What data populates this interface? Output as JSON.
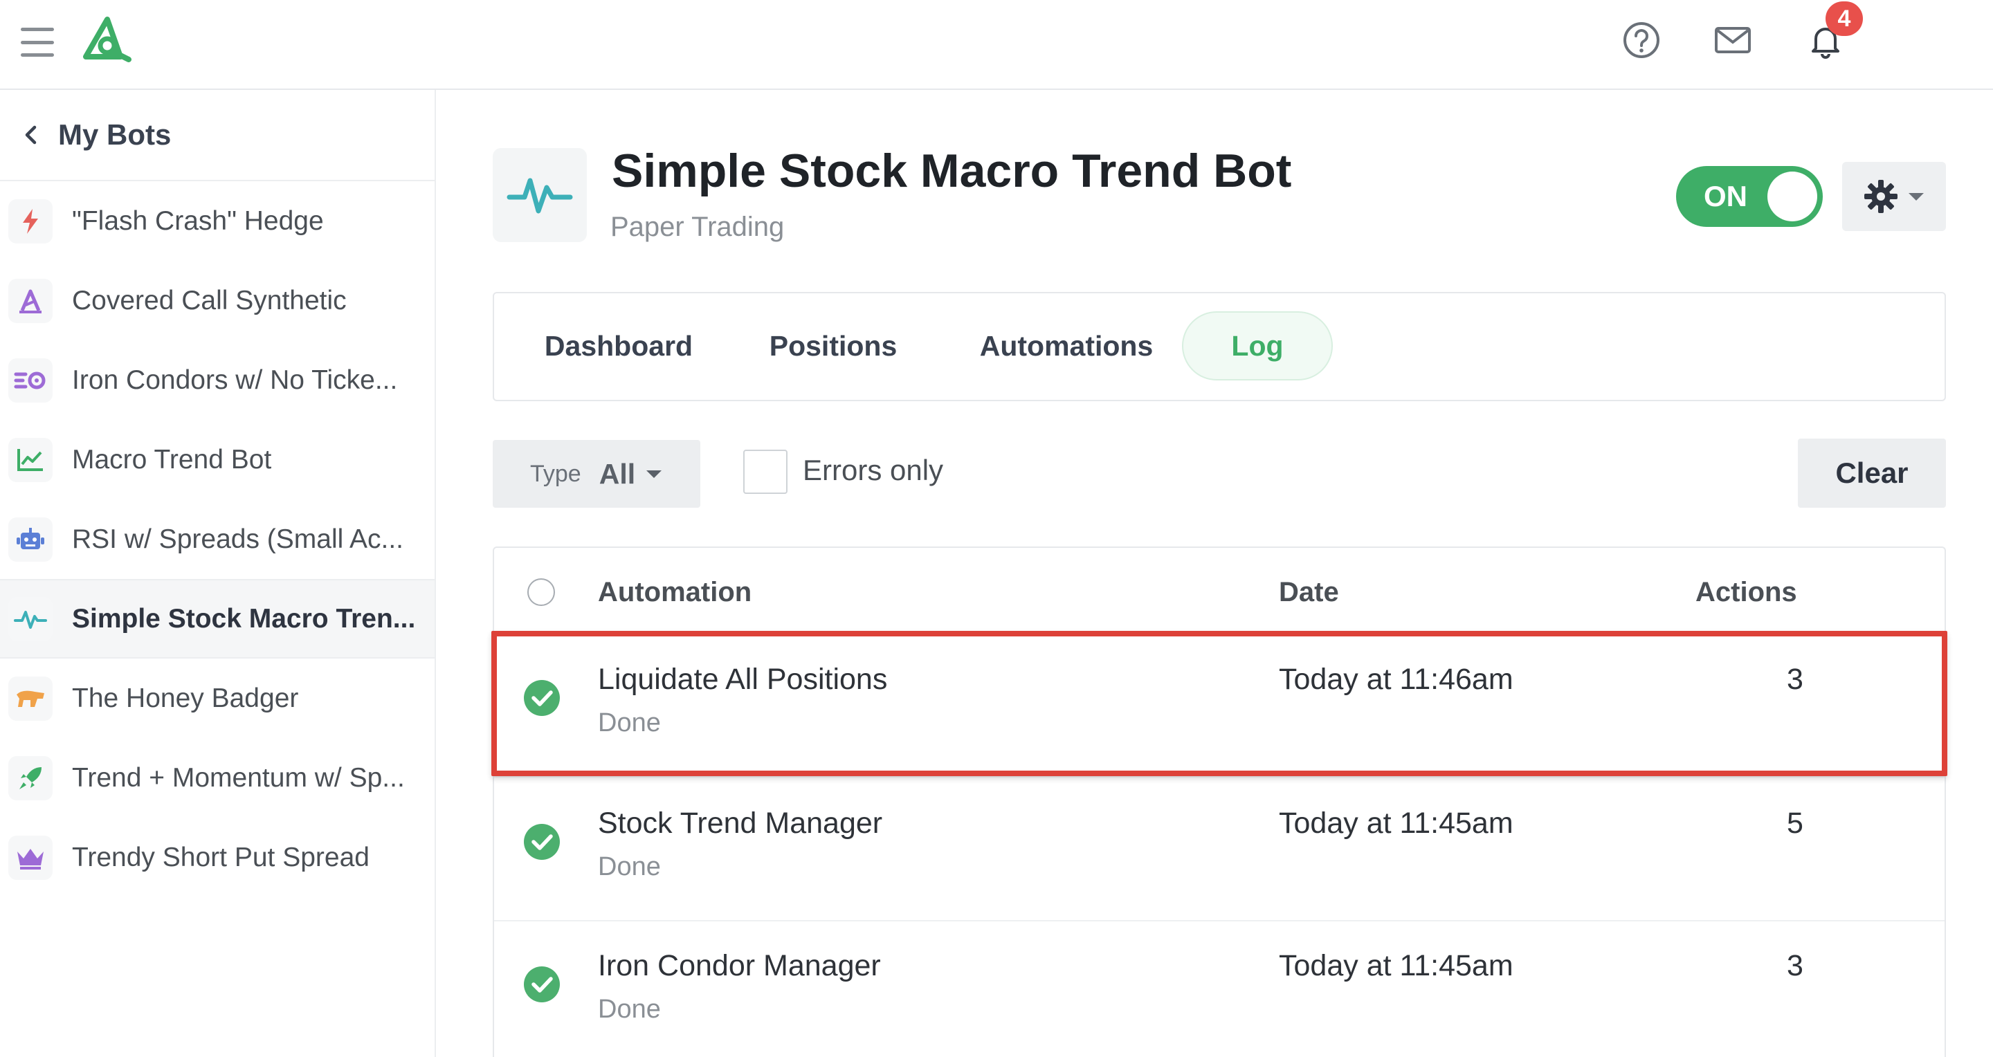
{
  "topbar": {
    "notification_count": "4",
    "icons": [
      "hamburger-menu-icon",
      "app-logo-icon",
      "help-icon",
      "mail-icon",
      "bell-icon"
    ]
  },
  "sidebar": {
    "back_label": "My Bots",
    "items": [
      {
        "label": "\"Flash Crash\" Hedge",
        "icon": "lightning-icon",
        "color": "#e5625c"
      },
      {
        "label": "Covered Call Synthetic",
        "icon": "letter-a-icon",
        "color": "#9d6bd6"
      },
      {
        "label": "Iron Condors w/ No Ticke...",
        "icon": "condor-icon",
        "color": "#9d6bd6"
      },
      {
        "label": "Macro Trend Bot",
        "icon": "chart-line-icon",
        "color": "#3eae67"
      },
      {
        "label": "RSI w/ Spreads (Small Ac...",
        "icon": "robot-icon",
        "color": "#5b7fd6"
      },
      {
        "label": "Simple Stock Macro Tren...",
        "icon": "pulse-icon",
        "color": "#3db0b8"
      },
      {
        "label": "The Honey Badger",
        "icon": "badger-icon",
        "color": "#f0a24a"
      },
      {
        "label": "Trend + Momentum w/ Sp...",
        "icon": "rocket-icon",
        "color": "#3eae67"
      },
      {
        "label": "Trendy Short Put Spread",
        "icon": "crown-icon",
        "color": "#9d6bd6"
      }
    ],
    "active_index": 5
  },
  "bot": {
    "title": "Simple Stock Macro Trend Bot",
    "subtitle": "Paper Trading",
    "icon": "pulse-icon",
    "toggle_label": "ON",
    "accent_color": "#3eae67"
  },
  "tabs": [
    {
      "label": "Dashboard"
    },
    {
      "label": "Positions"
    },
    {
      "label": "Automations"
    },
    {
      "label": "Log",
      "active": true
    }
  ],
  "filters": {
    "type_label": "Type",
    "type_value": "All",
    "errors_only_label": "Errors only",
    "errors_only_checked": false,
    "clear_label": "Clear"
  },
  "log": {
    "columns": {
      "automation": "Automation",
      "date": "Date",
      "actions": "Actions"
    },
    "rows": [
      {
        "name": "Liquidate All Positions",
        "status": "Done",
        "date": "Today at 11:46am",
        "actions": "3",
        "highlighted": true
      },
      {
        "name": "Stock Trend Manager",
        "status": "Done",
        "date": "Today at 11:45am",
        "actions": "5"
      },
      {
        "name": "Iron Condor Manager",
        "status": "Done",
        "date": "Today at 11:45am",
        "actions": "3"
      }
    ]
  },
  "colors": {
    "highlight": "#dd4138",
    "success": "#4caf6e",
    "badge": "#e8504b"
  }
}
